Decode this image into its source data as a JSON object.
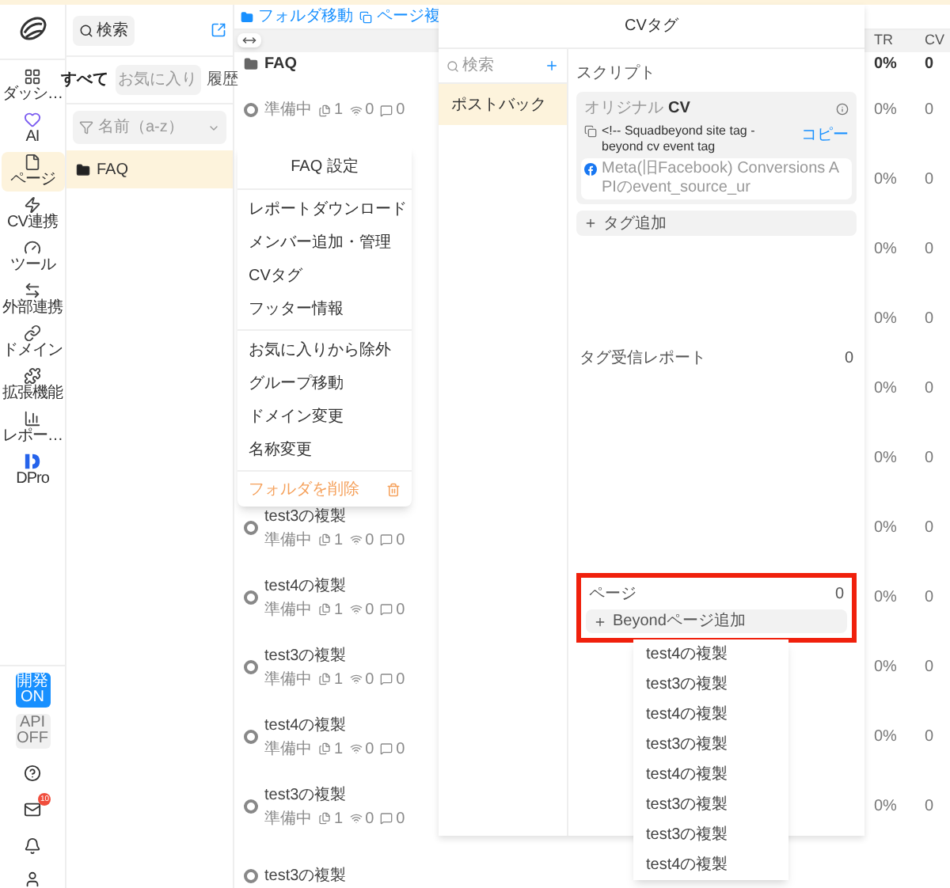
{
  "rail": {
    "items": [
      {
        "label": "ダッシ…",
        "selected": false
      },
      {
        "label": "AI",
        "selected": false
      },
      {
        "label": "ページ",
        "selected": true
      },
      {
        "label": "CV連携",
        "selected": false
      },
      {
        "label": "ツール",
        "selected": false
      },
      {
        "label": "外部連携",
        "selected": false
      },
      {
        "label": "ドメイン",
        "selected": false
      },
      {
        "label": "拡張機能",
        "selected": false
      },
      {
        "label": "レポー…",
        "selected": false
      },
      {
        "label": "DPro",
        "selected": false
      }
    ],
    "toggles": [
      {
        "label": "開発",
        "state": "ON",
        "on": true
      },
      {
        "label": "API",
        "state": "OFF",
        "on": false
      }
    ],
    "mail_badge": "10"
  },
  "sidebar": {
    "search": "検索",
    "tabs": [
      {
        "label": "すべて",
        "selected": true
      },
      {
        "label": "お気に入り",
        "selected": false
      },
      {
        "label": "履歴",
        "selected": false
      }
    ],
    "filter": "名前（a-z）",
    "folders": [
      {
        "name": "FAQ",
        "selected": true
      }
    ]
  },
  "toolbar": {
    "actions": [
      "フォルダ移動",
      "ページ複"
    ]
  },
  "table": {
    "columns": [
      "TR",
      "CV"
    ],
    "folder": {
      "name": "FAQ",
      "ctr": "0%",
      "cv": "0"
    },
    "rows": [
      {
        "status": "準備中",
        "counts": [
          "1",
          "0",
          "0"
        ],
        "ctr": "0%",
        "cv": "0"
      },
      {
        "ctr": "0%",
        "cv": "0"
      },
      {
        "ctr": "0%",
        "cv": "0"
      },
      {
        "ctr": "0%",
        "cv": "0"
      },
      {
        "ctr": "0%",
        "cv": "0"
      },
      {
        "ctr": "0%",
        "cv": "0"
      },
      {
        "name": "test3の複製",
        "status": "準備中",
        "counts": [
          "1",
          "0",
          "0"
        ],
        "ctr": "0%",
        "cv": "0"
      },
      {
        "name": "test4の複製",
        "status": "準備中",
        "counts": [
          "1",
          "0",
          "0"
        ],
        "ctr": "0%",
        "cv": "0"
      },
      {
        "name": "test3の複製",
        "status": "準備中",
        "counts": [
          "1",
          "0",
          "0"
        ],
        "ctr": "0%",
        "cv": "0"
      },
      {
        "name": "test4の複製",
        "status": "準備中",
        "counts": [
          "1",
          "0",
          "0"
        ],
        "ctr": "0%",
        "cv": "0"
      },
      {
        "name": "test3の複製",
        "status": "準備中",
        "counts": [
          "1",
          "0",
          "0"
        ],
        "ctr": "0%",
        "cv": "0"
      },
      {
        "name": "test3の複製"
      }
    ]
  },
  "context_menu": {
    "title": "FAQ 設定",
    "groups": [
      [
        "レポートダウンロード",
        "メンバー追加・管理",
        "CVタグ",
        "フッター情報"
      ],
      [
        "お気に入りから除外",
        "グループ移動",
        "ドメイン変更",
        "名称変更"
      ]
    ],
    "danger": "フォルダを削除"
  },
  "modal": {
    "title": "CVタグ",
    "search": "検索",
    "items": [
      {
        "label": "ポストバック",
        "selected": true
      }
    ],
    "script_label": "スクリプト",
    "card_label": "オリジナル",
    "card_name": "CV",
    "tag": "<!-- Squadbeyond site tag - beyond cv event tag",
    "copy": "コピー",
    "meta": "Meta(旧Facebook) Conversions APIのevent_source_ur",
    "add_tag": "タグ追加",
    "report_label": "タグ受信レポート",
    "report_count": "0",
    "page_label": "ページ",
    "page_count": "0",
    "add_page": "Beyondページ追加"
  },
  "page_dropdown": {
    "items": [
      "test4の複製",
      "test3の複製",
      "test4の複製",
      "test3の複製",
      "test4の複製",
      "test3の複製",
      "test3の複製",
      "test4の複製"
    ]
  }
}
